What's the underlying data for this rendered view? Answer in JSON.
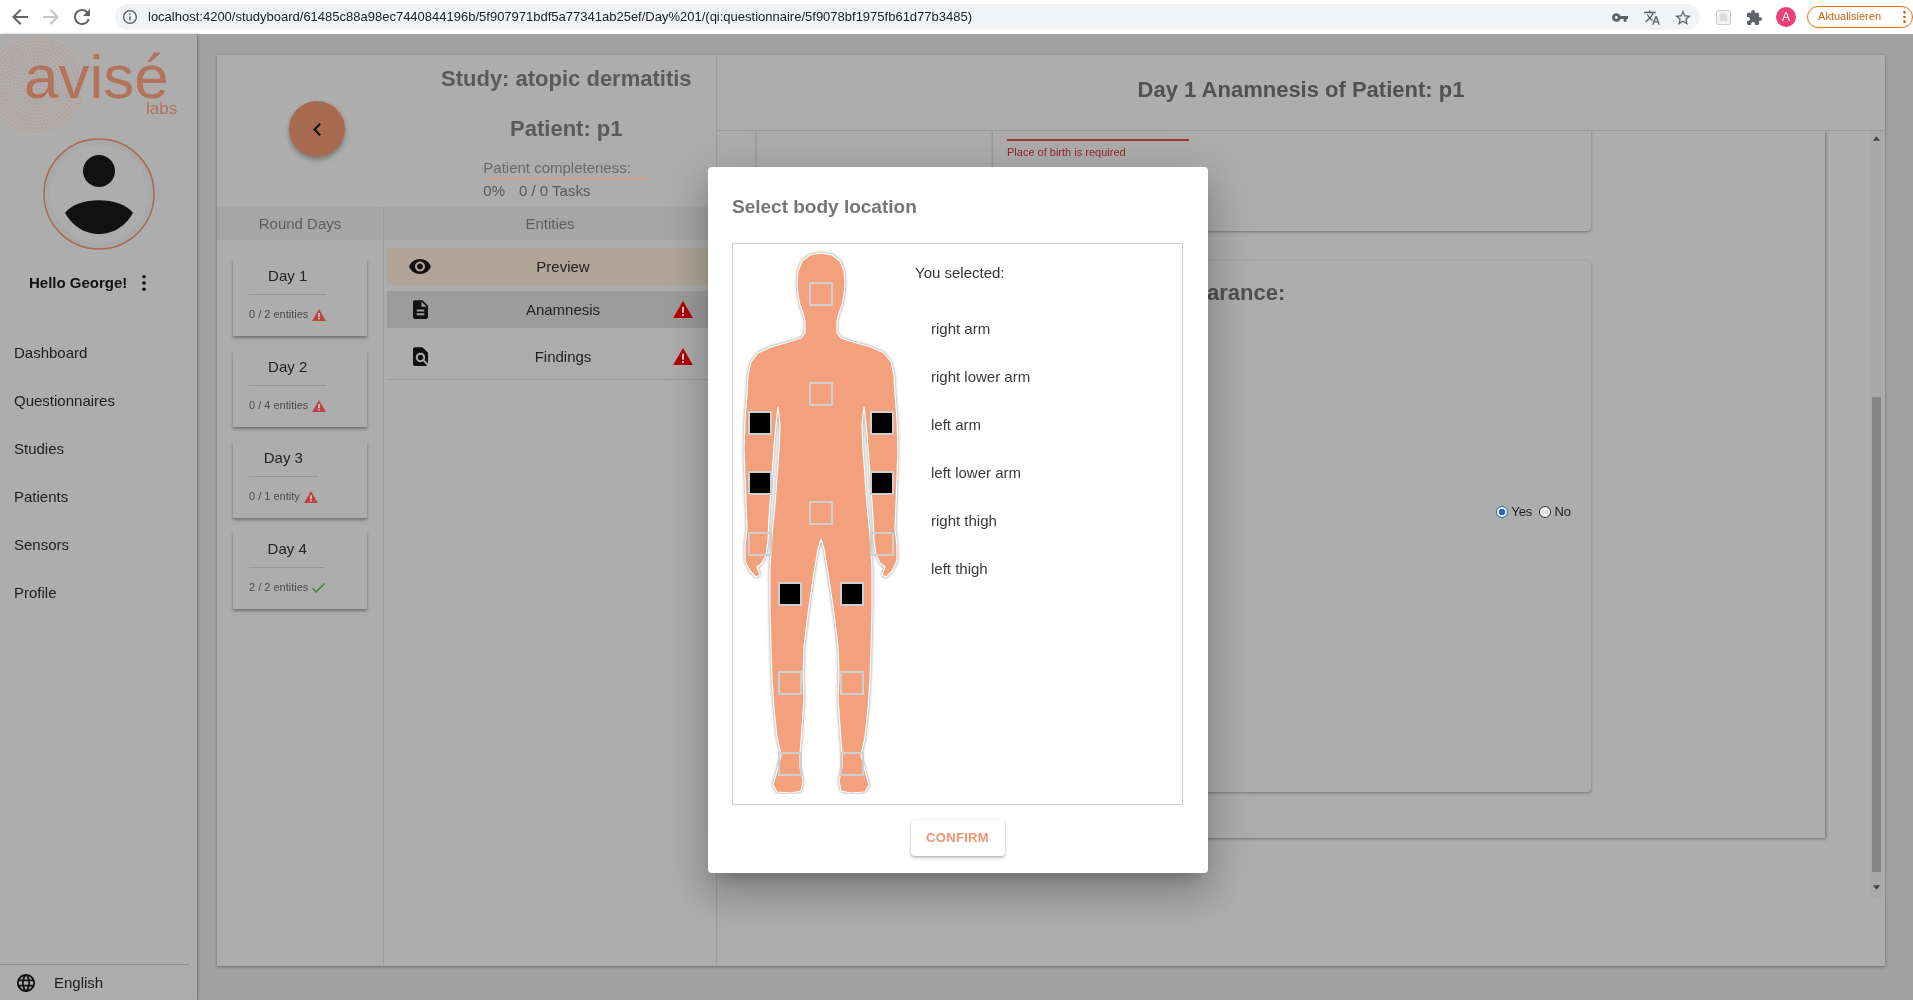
{
  "browser": {
    "nav_buttons": [
      {
        "kind": "back",
        "disabled": false
      },
      {
        "kind": "forward",
        "disabled": true
      },
      {
        "kind": "reload",
        "disabled": false
      }
    ],
    "url": "localhost:4200/studyboard/61485c88a98ec7440844196b/5f907971bdf5a77341ab25ef/Day%201/(qi:questionnaire/5f9078bf1975fb61d77b3485)",
    "profile_initial": "A",
    "update_button": "Aktualisieren"
  },
  "sidebar": {
    "logo": {
      "wordmark": "avisé",
      "suffix": "labs"
    },
    "greeting": "Hello George!",
    "items": [
      "Dashboard",
      "Questionnaires",
      "Studies",
      "Patients",
      "Sensors",
      "Profile"
    ],
    "language": "English"
  },
  "study": {
    "title": "Study: atopic dermatitis",
    "patient": "Patient: p1",
    "completeness": {
      "label": "Patient completeness:",
      "level": 0,
      "percent": "0%",
      "tasks": "0 / 0 Tasks"
    },
    "columns": [
      "Round Days",
      "Entities"
    ],
    "days": [
      {
        "title": "Day 1",
        "summary": "0 / 2 entities",
        "complete": false
      },
      {
        "title": "Day 2",
        "summary": "0 / 4 entities",
        "complete": false
      },
      {
        "title": "Day 3",
        "summary": "0 / 1 entity",
        "complete": false
      },
      {
        "title": "Day 4",
        "summary": "2 / 2 entities",
        "complete": true
      }
    ],
    "entities": [
      {
        "kind": "preview",
        "label": "Preview",
        "selected": false,
        "incomplete": false
      },
      {
        "kind": "document",
        "label": "Anamnesis",
        "selected": true,
        "incomplete": true
      },
      {
        "kind": "findings",
        "label": "Findings",
        "selected": false,
        "incomplete": true
      }
    ]
  },
  "questionnaire": {
    "title": "Day 1 Anamnesis of Patient: p1",
    "place_field": {
      "invalid": true,
      "error": "Place of birth is required"
    },
    "section_heading": "arance:",
    "radio": [
      {
        "label": "Yes",
        "selected": true
      },
      {
        "label": "No",
        "selected": false
      }
    ]
  },
  "modal": {
    "title": "Select body location",
    "selected_heading": "You selected:",
    "selected_parts": [
      "right arm",
      "right lower arm",
      "left arm",
      "left lower arm",
      "right thigh",
      "left thigh"
    ],
    "markers": [
      {
        "selected": false
      },
      {
        "selected": false
      },
      {
        "selected": true
      },
      {
        "selected": true
      },
      {
        "selected": true
      },
      {
        "selected": true
      },
      {
        "selected": false
      },
      {
        "selected": false
      },
      {
        "selected": false
      },
      {
        "selected": true
      },
      {
        "selected": true
      },
      {
        "selected": false
      },
      {
        "selected": false
      },
      {
        "selected": false
      },
      {
        "selected": false
      }
    ],
    "confirm": "CONFIRM"
  }
}
